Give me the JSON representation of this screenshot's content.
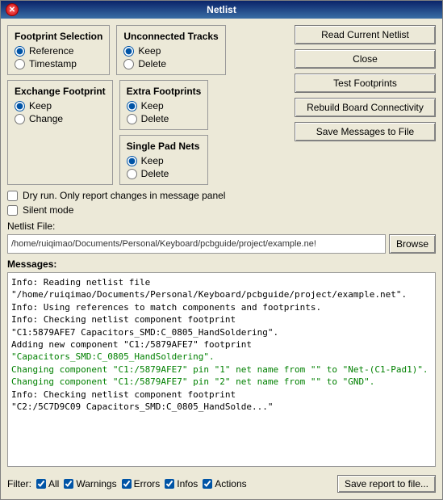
{
  "window": {
    "title": "Netlist"
  },
  "footprint_selection": {
    "title": "Footprint Selection",
    "options": [
      {
        "label": "Reference",
        "checked": true
      },
      {
        "label": "Timestamp",
        "checked": false
      }
    ]
  },
  "unconnected_tracks": {
    "title": "Unconnected Tracks",
    "options": [
      {
        "label": "Keep",
        "checked": true
      },
      {
        "label": "Delete",
        "checked": false
      }
    ]
  },
  "exchange_footprint": {
    "title": "Exchange Footprint",
    "options": [
      {
        "label": "Keep",
        "checked": true
      },
      {
        "label": "Change",
        "checked": false
      }
    ]
  },
  "extra_footprints": {
    "title": "Extra Footprints",
    "options": [
      {
        "label": "Keep",
        "checked": true
      },
      {
        "label": "Delete",
        "checked": false
      }
    ]
  },
  "single_pad_nets": {
    "title": "Single Pad Nets",
    "options": [
      {
        "label": "Keep",
        "checked": true
      },
      {
        "label": "Delete",
        "checked": false
      }
    ]
  },
  "buttons": {
    "read_current_netlist": "Read Current Netlist",
    "close": "Close",
    "test_footprints": "Test Footprints",
    "rebuild_board_connectivity": "Rebuild Board Connectivity",
    "save_messages": "Save Messages to File"
  },
  "checkboxes": {
    "dry_run": {
      "label": "Dry run. Only report changes in message panel",
      "checked": false
    },
    "silent_mode": {
      "label": "Silent mode",
      "checked": false
    }
  },
  "netlist_file": {
    "label": "Netlist File:",
    "value": "/home/ruiqimao/Documents/Personal/Keyboard/pcbguide/project/example.ne!",
    "browse": "Browse"
  },
  "messages": {
    "label": "Messages:",
    "lines": [
      {
        "type": "info",
        "text": "Info: Reading netlist file"
      },
      {
        "type": "info",
        "text": "\"/home/ruiqimao/Documents/Personal/Keyboard/pcbguide/project/example.net\"."
      },
      {
        "type": "info",
        "text": "Info: Using references to match components and footprints."
      },
      {
        "type": "info",
        "text": "Info: Checking netlist component footprint"
      },
      {
        "type": "info",
        "text": "\"C1:5879AFE7 Capacitors_SMD:C_0805_HandSoldering\"."
      },
      {
        "type": "info",
        "text": "Adding new component \"C1:/5879AFE7\"footprint"
      },
      {
        "type": "green",
        "text": "\"Capacitors_SMD:C_0805_HandSoldering\"."
      },
      {
        "type": "green",
        "text": "Changing component \"C1:/5879AFE7\" pin \"1\" net name from \"\" to \"Net-(C1-Pad1)\"."
      },
      {
        "type": "green",
        "text": "Changing component \"C1:/5879AFE7\" pin \"2\" net name from \"\" to \"GND\"."
      },
      {
        "type": "info",
        "text": "Info: Checking netlist component footprint"
      },
      {
        "type": "info",
        "text": "\"C2:/5C7D9C09 Capacitors_SMD:C_0805_HandSolde...\""
      }
    ]
  },
  "filter": {
    "label": "Filter:",
    "all": {
      "label": "All",
      "checked": true
    },
    "warnings": {
      "label": "Warnings",
      "checked": true
    },
    "errors": {
      "label": "Errors",
      "checked": true
    },
    "infos": {
      "label": "Infos",
      "checked": true
    },
    "actions": {
      "label": "Actions",
      "checked": true
    },
    "save_report": "Save report to file..."
  }
}
